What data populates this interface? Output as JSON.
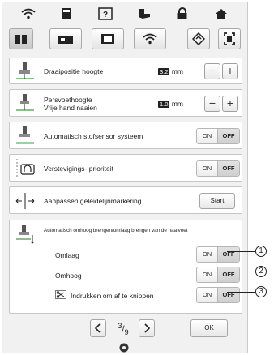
{
  "topbar": {
    "icons": [
      "wifi-icon",
      "page-icon",
      "help-icon",
      "foot-icon",
      "lock-icon",
      "home-icon"
    ]
  },
  "row2": {
    "icons": [
      "book-icon",
      "machine-icon",
      "screen-icon",
      "wifi-setting-icon",
      "diamond-icon",
      "frame-icon"
    ]
  },
  "settings": {
    "presser_height": {
      "label": "Draaipositie hoogte",
      "value": "3.2",
      "unit": "mm"
    },
    "presser_freemotion": {
      "label_line1": "Persvoethoogte",
      "label_line2": "Vrije hand naaien",
      "value": "1.0",
      "unit": "mm"
    },
    "auto_sensor": {
      "label": "Automatisch stofsensor systeem",
      "on": "ON",
      "off": "OFF"
    },
    "reinforce_priority": {
      "label": "Verstevigings- prioriteit",
      "on": "ON",
      "off": "OFF"
    },
    "guideline": {
      "label": "Aanpassen geleidelijnmarkering",
      "button": "Start"
    },
    "auto_presser": {
      "header": "Automatisch omhoog brengen/omlaag brengen van de naaivoet",
      "rows": [
        {
          "label": "Omlaag",
          "on": "ON",
          "off": "OFF",
          "callout": "1"
        },
        {
          "label": "Omhoog",
          "on": "ON",
          "off": "OFF",
          "callout": "2"
        },
        {
          "label": "Indrukken om af te knippen",
          "on": "ON",
          "off": "OFF",
          "callout": "3"
        }
      ]
    }
  },
  "footer": {
    "page_current": "3",
    "page_total": "9",
    "ok": "OK"
  }
}
